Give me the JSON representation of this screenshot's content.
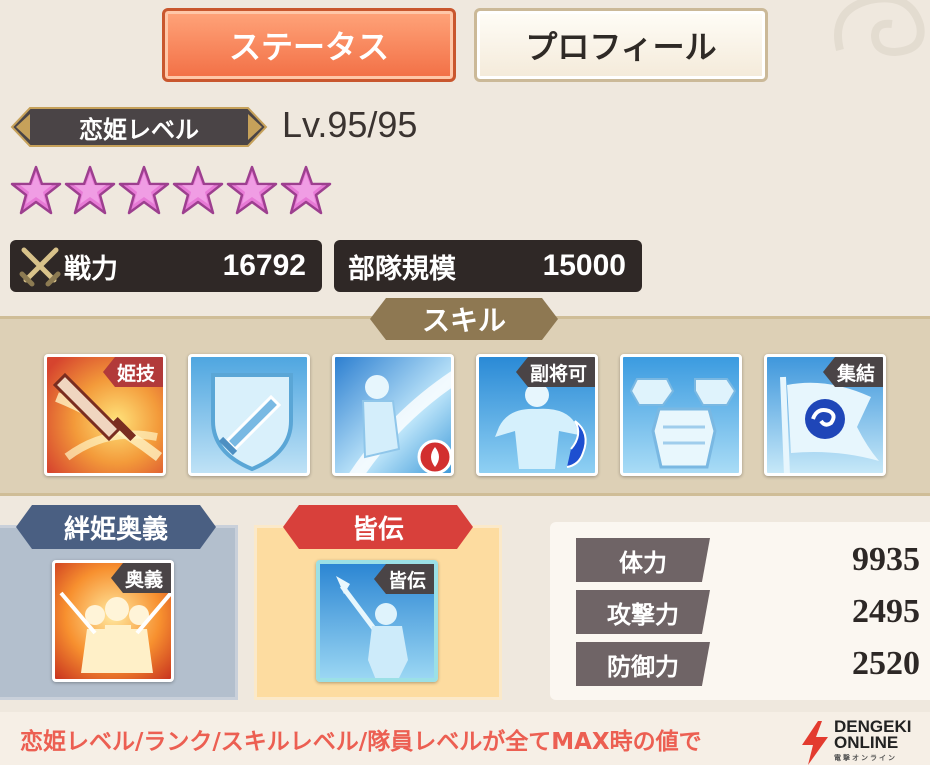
{
  "tabs": [
    {
      "label": "ステータス",
      "active": true
    },
    {
      "label": "プロフィール",
      "active": false
    }
  ],
  "level": {
    "badge_label": "恋姫レベル",
    "value": "Lv.95/95"
  },
  "rank": {
    "stars": 6,
    "star_color": "#e77ad6"
  },
  "power": {
    "icon": "crossed-swords-icon",
    "label": "戦力",
    "value": "16792"
  },
  "troops": {
    "label": "部隊規模",
    "value": "15000"
  },
  "skills": {
    "title": "スキル",
    "items": [
      {
        "icon": "sword-burst-icon",
        "tag": "姫技",
        "theme": "red"
      },
      {
        "icon": "shield-sword-icon",
        "tag": "",
        "theme": "blue"
      },
      {
        "icon": "warrior-slash-icon",
        "tag": "",
        "theme": "blue",
        "element": "fire"
      },
      {
        "icon": "muscle-figure-icon",
        "tag": "副将可",
        "theme": "blue",
        "element": "water"
      },
      {
        "icon": "armor-set-icon",
        "tag": "",
        "theme": "blue"
      },
      {
        "icon": "flag-swirl-icon",
        "tag": "集結",
        "theme": "blue"
      }
    ]
  },
  "kizuna": {
    "title": "絆姫奥義",
    "icon": "group-attack-icon",
    "tag": "奥義"
  },
  "minaden": {
    "title": "皆伝",
    "icon": "spear-warrior-icon",
    "tag": "皆伝"
  },
  "stats": [
    {
      "label": "体力",
      "value": "9935"
    },
    {
      "label": "攻撃力",
      "value": "2495"
    },
    {
      "label": "防御力",
      "value": "2520"
    }
  ],
  "footer": {
    "note": "恋姫レベル/ランク/スキルレベル/隊員レベルが全てMAX時の値で",
    "logo_line1": "DENGEKI",
    "logo_line2": "ONLINE",
    "logo_sub": "電撃オンライン"
  }
}
